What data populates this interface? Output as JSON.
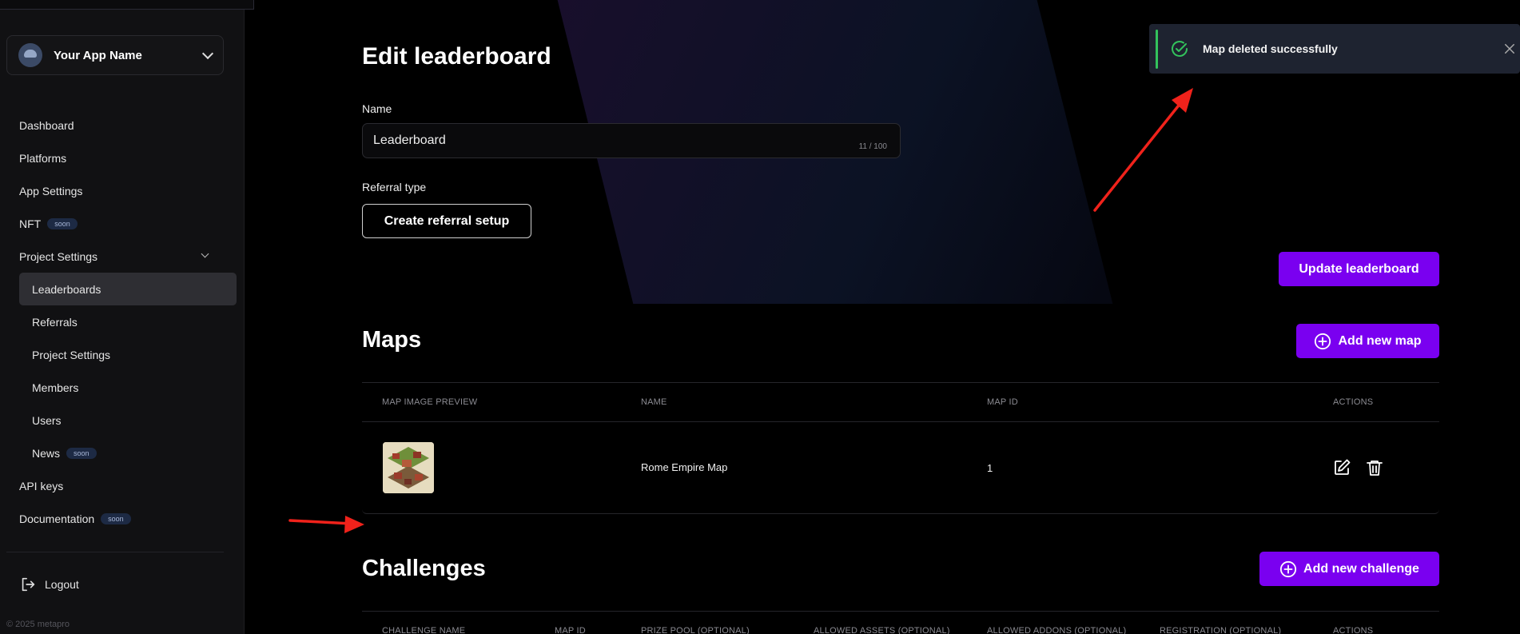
{
  "sidebar": {
    "app_name": "Your App Name",
    "items": [
      {
        "label": "Dashboard"
      },
      {
        "label": "Platforms"
      },
      {
        "label": "App Settings"
      },
      {
        "label": "NFT",
        "badge": "soon"
      },
      {
        "label": "Project Settings"
      },
      {
        "label": "Leaderboards"
      },
      {
        "label": "Referrals"
      },
      {
        "label": "Project Settings"
      },
      {
        "label": "Members"
      },
      {
        "label": "Users"
      },
      {
        "label": "News",
        "badge": "soon"
      },
      {
        "label": "API keys"
      },
      {
        "label": "Documentation",
        "badge": "soon"
      }
    ],
    "logout": "Logout",
    "copyright": "© 2025 metapro"
  },
  "main": {
    "title": "Edit leaderboard",
    "name_label": "Name",
    "name_value": "Leaderboard",
    "name_counter": "11 / 100",
    "referral_label": "Referral type",
    "referral_button": "Create referral setup",
    "update_button": "Update leaderboard",
    "maps": {
      "title": "Maps",
      "add_button": "Add new map",
      "columns": [
        "MAP IMAGE PREVIEW",
        "NAME",
        "MAP ID",
        "ACTIONS"
      ],
      "rows": [
        {
          "name": "Rome Empire Map",
          "id": "1"
        }
      ]
    },
    "challenges": {
      "title": "Challenges",
      "add_button": "Add new challenge",
      "columns": [
        "CHALLENGE NAME",
        "MAP ID",
        "PRIZE POOL (OPTIONAL)",
        "ALLOWED ASSETS (OPTIONAL)",
        "ALLOWED ADDONS (OPTIONAL)",
        "REGISTRATION (OPTIONAL)",
        "ACTIONS"
      ]
    }
  },
  "toast": {
    "message": "Map deleted successfully",
    "color": "#33c25c"
  },
  "colors": {
    "accent": "#7a00f0",
    "annotation_arrow": "#f0221b"
  }
}
